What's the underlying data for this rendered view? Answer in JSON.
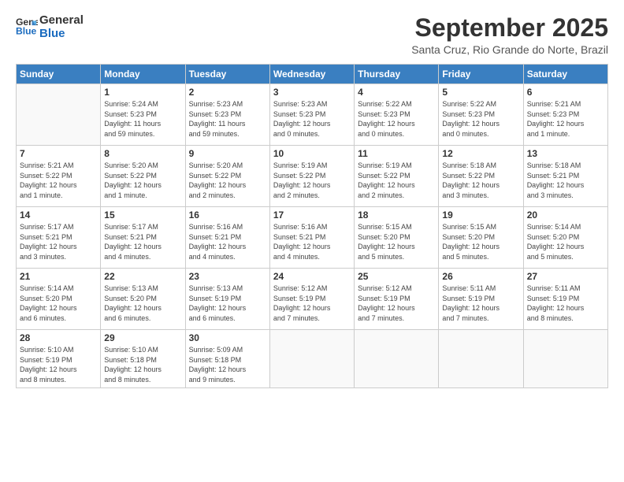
{
  "logo": {
    "line1": "General",
    "line2": "Blue"
  },
  "title": "September 2025",
  "location": "Santa Cruz, Rio Grande do Norte, Brazil",
  "days_of_week": [
    "Sunday",
    "Monday",
    "Tuesday",
    "Wednesday",
    "Thursday",
    "Friday",
    "Saturday"
  ],
  "weeks": [
    [
      {
        "day": "",
        "info": ""
      },
      {
        "day": "1",
        "info": "Sunrise: 5:24 AM\nSunset: 5:23 PM\nDaylight: 11 hours\nand 59 minutes."
      },
      {
        "day": "2",
        "info": "Sunrise: 5:23 AM\nSunset: 5:23 PM\nDaylight: 11 hours\nand 59 minutes."
      },
      {
        "day": "3",
        "info": "Sunrise: 5:23 AM\nSunset: 5:23 PM\nDaylight: 12 hours\nand 0 minutes."
      },
      {
        "day": "4",
        "info": "Sunrise: 5:22 AM\nSunset: 5:23 PM\nDaylight: 12 hours\nand 0 minutes."
      },
      {
        "day": "5",
        "info": "Sunrise: 5:22 AM\nSunset: 5:23 PM\nDaylight: 12 hours\nand 0 minutes."
      },
      {
        "day": "6",
        "info": "Sunrise: 5:21 AM\nSunset: 5:23 PM\nDaylight: 12 hours\nand 1 minute."
      }
    ],
    [
      {
        "day": "7",
        "info": "Sunrise: 5:21 AM\nSunset: 5:22 PM\nDaylight: 12 hours\nand 1 minute."
      },
      {
        "day": "8",
        "info": "Sunrise: 5:20 AM\nSunset: 5:22 PM\nDaylight: 12 hours\nand 1 minute."
      },
      {
        "day": "9",
        "info": "Sunrise: 5:20 AM\nSunset: 5:22 PM\nDaylight: 12 hours\nand 2 minutes."
      },
      {
        "day": "10",
        "info": "Sunrise: 5:19 AM\nSunset: 5:22 PM\nDaylight: 12 hours\nand 2 minutes."
      },
      {
        "day": "11",
        "info": "Sunrise: 5:19 AM\nSunset: 5:22 PM\nDaylight: 12 hours\nand 2 minutes."
      },
      {
        "day": "12",
        "info": "Sunrise: 5:18 AM\nSunset: 5:22 PM\nDaylight: 12 hours\nand 3 minutes."
      },
      {
        "day": "13",
        "info": "Sunrise: 5:18 AM\nSunset: 5:21 PM\nDaylight: 12 hours\nand 3 minutes."
      }
    ],
    [
      {
        "day": "14",
        "info": "Sunrise: 5:17 AM\nSunset: 5:21 PM\nDaylight: 12 hours\nand 3 minutes."
      },
      {
        "day": "15",
        "info": "Sunrise: 5:17 AM\nSunset: 5:21 PM\nDaylight: 12 hours\nand 4 minutes."
      },
      {
        "day": "16",
        "info": "Sunrise: 5:16 AM\nSunset: 5:21 PM\nDaylight: 12 hours\nand 4 minutes."
      },
      {
        "day": "17",
        "info": "Sunrise: 5:16 AM\nSunset: 5:21 PM\nDaylight: 12 hours\nand 4 minutes."
      },
      {
        "day": "18",
        "info": "Sunrise: 5:15 AM\nSunset: 5:20 PM\nDaylight: 12 hours\nand 5 minutes."
      },
      {
        "day": "19",
        "info": "Sunrise: 5:15 AM\nSunset: 5:20 PM\nDaylight: 12 hours\nand 5 minutes."
      },
      {
        "day": "20",
        "info": "Sunrise: 5:14 AM\nSunset: 5:20 PM\nDaylight: 12 hours\nand 5 minutes."
      }
    ],
    [
      {
        "day": "21",
        "info": "Sunrise: 5:14 AM\nSunset: 5:20 PM\nDaylight: 12 hours\nand 6 minutes."
      },
      {
        "day": "22",
        "info": "Sunrise: 5:13 AM\nSunset: 5:20 PM\nDaylight: 12 hours\nand 6 minutes."
      },
      {
        "day": "23",
        "info": "Sunrise: 5:13 AM\nSunset: 5:19 PM\nDaylight: 12 hours\nand 6 minutes."
      },
      {
        "day": "24",
        "info": "Sunrise: 5:12 AM\nSunset: 5:19 PM\nDaylight: 12 hours\nand 7 minutes."
      },
      {
        "day": "25",
        "info": "Sunrise: 5:12 AM\nSunset: 5:19 PM\nDaylight: 12 hours\nand 7 minutes."
      },
      {
        "day": "26",
        "info": "Sunrise: 5:11 AM\nSunset: 5:19 PM\nDaylight: 12 hours\nand 7 minutes."
      },
      {
        "day": "27",
        "info": "Sunrise: 5:11 AM\nSunset: 5:19 PM\nDaylight: 12 hours\nand 8 minutes."
      }
    ],
    [
      {
        "day": "28",
        "info": "Sunrise: 5:10 AM\nSunset: 5:19 PM\nDaylight: 12 hours\nand 8 minutes."
      },
      {
        "day": "29",
        "info": "Sunrise: 5:10 AM\nSunset: 5:18 PM\nDaylight: 12 hours\nand 8 minutes."
      },
      {
        "day": "30",
        "info": "Sunrise: 5:09 AM\nSunset: 5:18 PM\nDaylight: 12 hours\nand 9 minutes."
      },
      {
        "day": "",
        "info": ""
      },
      {
        "day": "",
        "info": ""
      },
      {
        "day": "",
        "info": ""
      },
      {
        "day": "",
        "info": ""
      }
    ]
  ]
}
